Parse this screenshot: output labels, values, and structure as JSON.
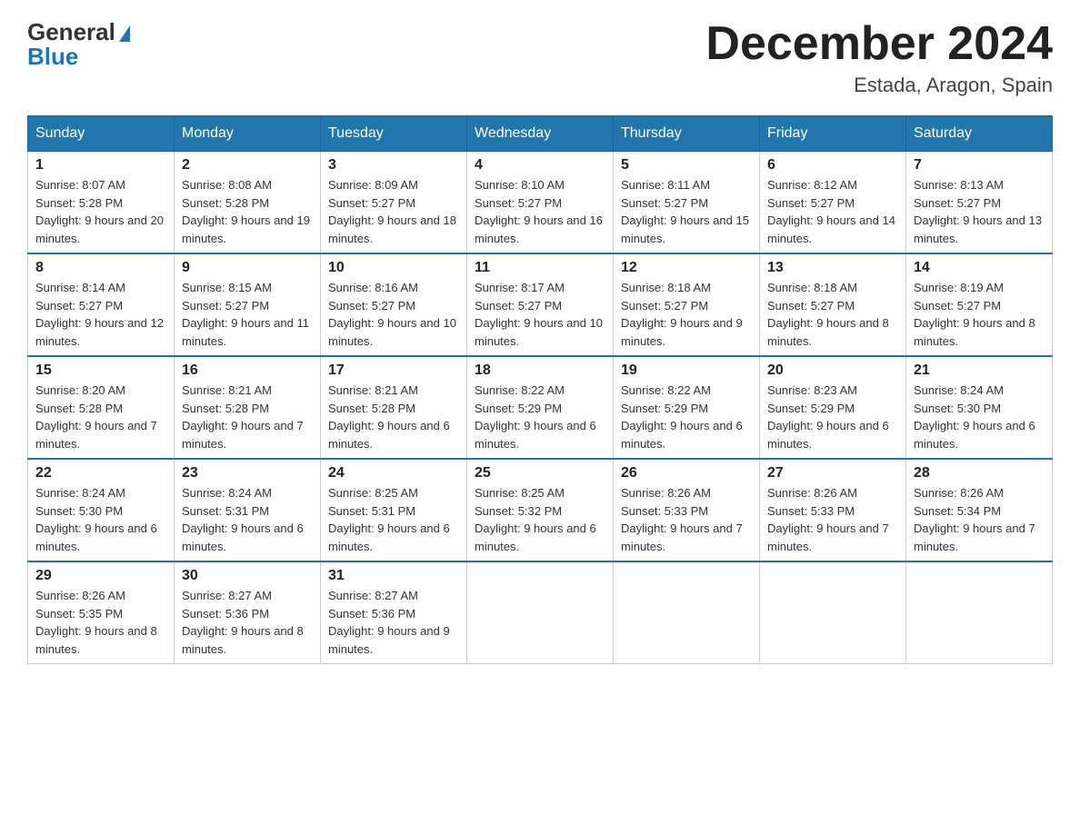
{
  "logo": {
    "general": "General",
    "blue": "Blue"
  },
  "title": "December 2024",
  "location": "Estada, Aragon, Spain",
  "days_of_week": [
    "Sunday",
    "Monday",
    "Tuesday",
    "Wednesday",
    "Thursday",
    "Friday",
    "Saturday"
  ],
  "weeks": [
    [
      {
        "day": "1",
        "sunrise": "8:07 AM",
        "sunset": "5:28 PM",
        "daylight": "9 hours and 20 minutes."
      },
      {
        "day": "2",
        "sunrise": "8:08 AM",
        "sunset": "5:28 PM",
        "daylight": "9 hours and 19 minutes."
      },
      {
        "day": "3",
        "sunrise": "8:09 AM",
        "sunset": "5:27 PM",
        "daylight": "9 hours and 18 minutes."
      },
      {
        "day": "4",
        "sunrise": "8:10 AM",
        "sunset": "5:27 PM",
        "daylight": "9 hours and 16 minutes."
      },
      {
        "day": "5",
        "sunrise": "8:11 AM",
        "sunset": "5:27 PM",
        "daylight": "9 hours and 15 minutes."
      },
      {
        "day": "6",
        "sunrise": "8:12 AM",
        "sunset": "5:27 PM",
        "daylight": "9 hours and 14 minutes."
      },
      {
        "day": "7",
        "sunrise": "8:13 AM",
        "sunset": "5:27 PM",
        "daylight": "9 hours and 13 minutes."
      }
    ],
    [
      {
        "day": "8",
        "sunrise": "8:14 AM",
        "sunset": "5:27 PM",
        "daylight": "9 hours and 12 minutes."
      },
      {
        "day": "9",
        "sunrise": "8:15 AM",
        "sunset": "5:27 PM",
        "daylight": "9 hours and 11 minutes."
      },
      {
        "day": "10",
        "sunrise": "8:16 AM",
        "sunset": "5:27 PM",
        "daylight": "9 hours and 10 minutes."
      },
      {
        "day": "11",
        "sunrise": "8:17 AM",
        "sunset": "5:27 PM",
        "daylight": "9 hours and 10 minutes."
      },
      {
        "day": "12",
        "sunrise": "8:18 AM",
        "sunset": "5:27 PM",
        "daylight": "9 hours and 9 minutes."
      },
      {
        "day": "13",
        "sunrise": "8:18 AM",
        "sunset": "5:27 PM",
        "daylight": "9 hours and 8 minutes."
      },
      {
        "day": "14",
        "sunrise": "8:19 AM",
        "sunset": "5:27 PM",
        "daylight": "9 hours and 8 minutes."
      }
    ],
    [
      {
        "day": "15",
        "sunrise": "8:20 AM",
        "sunset": "5:28 PM",
        "daylight": "9 hours and 7 minutes."
      },
      {
        "day": "16",
        "sunrise": "8:21 AM",
        "sunset": "5:28 PM",
        "daylight": "9 hours and 7 minutes."
      },
      {
        "day": "17",
        "sunrise": "8:21 AM",
        "sunset": "5:28 PM",
        "daylight": "9 hours and 6 minutes."
      },
      {
        "day": "18",
        "sunrise": "8:22 AM",
        "sunset": "5:29 PM",
        "daylight": "9 hours and 6 minutes."
      },
      {
        "day": "19",
        "sunrise": "8:22 AM",
        "sunset": "5:29 PM",
        "daylight": "9 hours and 6 minutes."
      },
      {
        "day": "20",
        "sunrise": "8:23 AM",
        "sunset": "5:29 PM",
        "daylight": "9 hours and 6 minutes."
      },
      {
        "day": "21",
        "sunrise": "8:24 AM",
        "sunset": "5:30 PM",
        "daylight": "9 hours and 6 minutes."
      }
    ],
    [
      {
        "day": "22",
        "sunrise": "8:24 AM",
        "sunset": "5:30 PM",
        "daylight": "9 hours and 6 minutes."
      },
      {
        "day": "23",
        "sunrise": "8:24 AM",
        "sunset": "5:31 PM",
        "daylight": "9 hours and 6 minutes."
      },
      {
        "day": "24",
        "sunrise": "8:25 AM",
        "sunset": "5:31 PM",
        "daylight": "9 hours and 6 minutes."
      },
      {
        "day": "25",
        "sunrise": "8:25 AM",
        "sunset": "5:32 PM",
        "daylight": "9 hours and 6 minutes."
      },
      {
        "day": "26",
        "sunrise": "8:26 AM",
        "sunset": "5:33 PM",
        "daylight": "9 hours and 7 minutes."
      },
      {
        "day": "27",
        "sunrise": "8:26 AM",
        "sunset": "5:33 PM",
        "daylight": "9 hours and 7 minutes."
      },
      {
        "day": "28",
        "sunrise": "8:26 AM",
        "sunset": "5:34 PM",
        "daylight": "9 hours and 7 minutes."
      }
    ],
    [
      {
        "day": "29",
        "sunrise": "8:26 AM",
        "sunset": "5:35 PM",
        "daylight": "9 hours and 8 minutes."
      },
      {
        "day": "30",
        "sunrise": "8:27 AM",
        "sunset": "5:36 PM",
        "daylight": "9 hours and 8 minutes."
      },
      {
        "day": "31",
        "sunrise": "8:27 AM",
        "sunset": "5:36 PM",
        "daylight": "9 hours and 9 minutes."
      },
      null,
      null,
      null,
      null
    ]
  ]
}
